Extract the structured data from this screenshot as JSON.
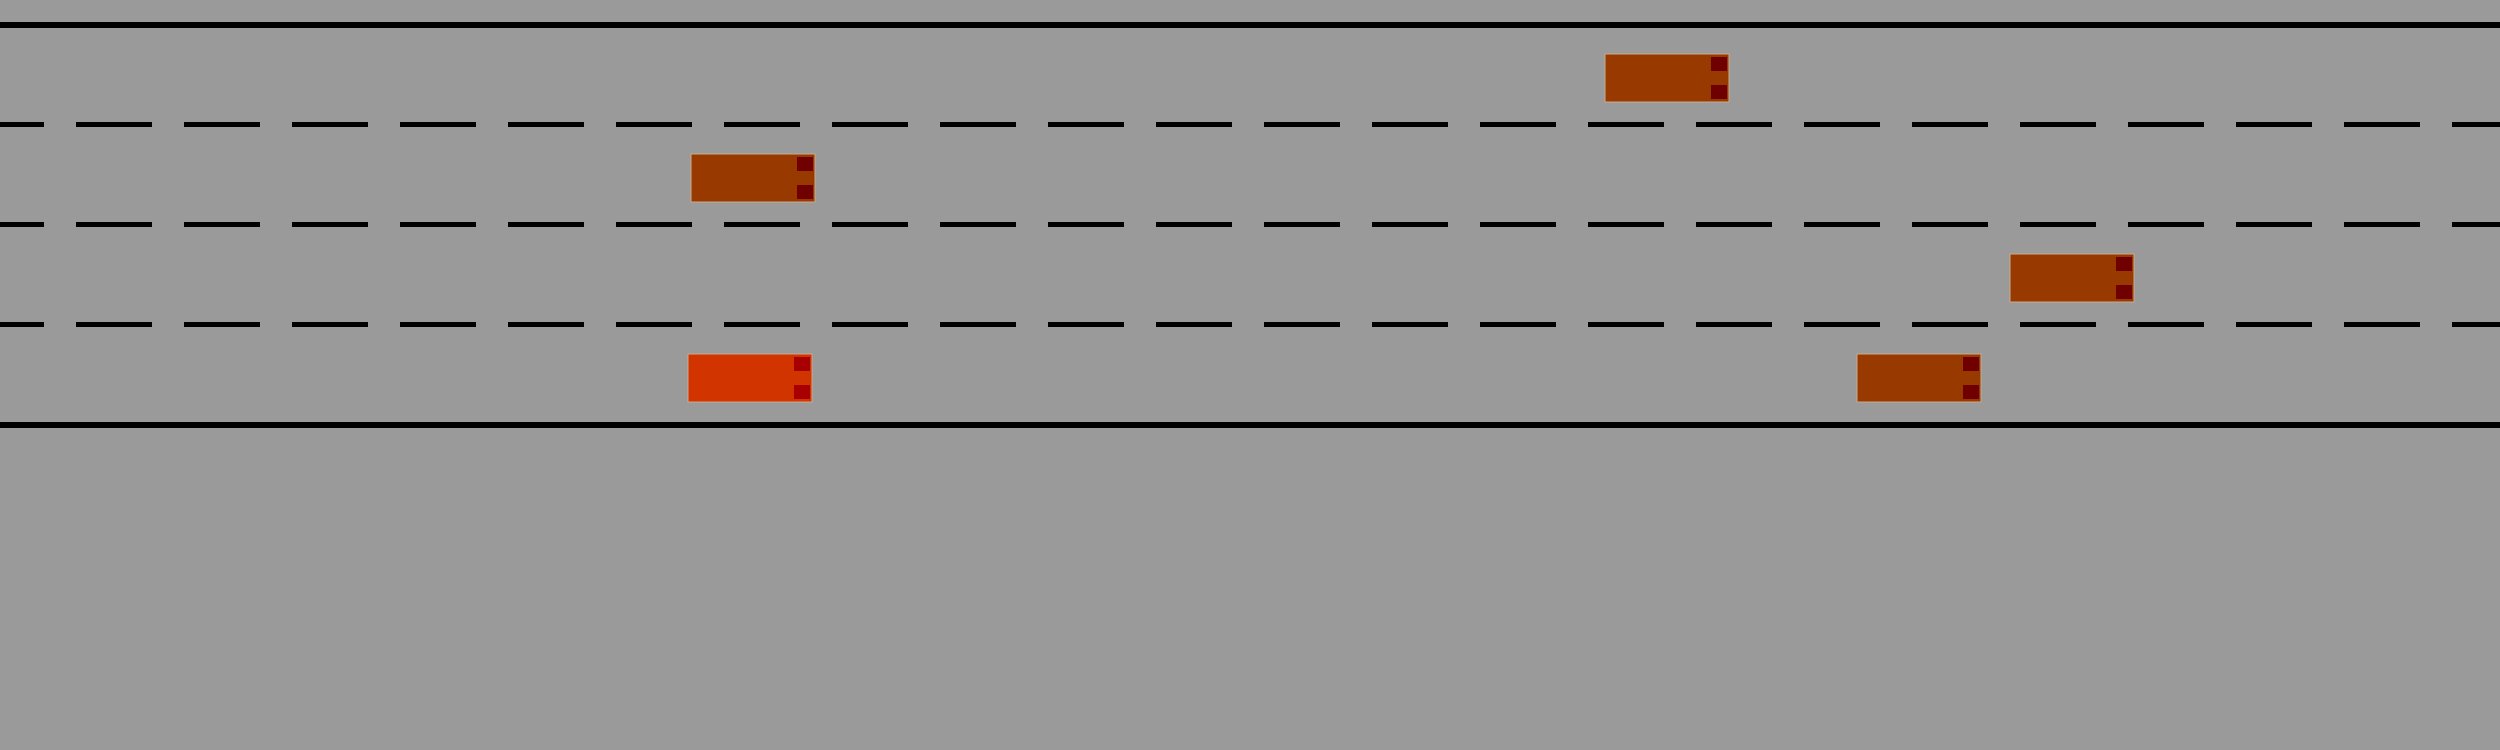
{
  "scene": {
    "type": "highway-driving-simulation",
    "background_color": "#9a9a9a",
    "road": {
      "lane_count": 4,
      "edge_line_color": "#000000",
      "lane_divider_color": "#000000",
      "lane_divider_style": "dashed"
    },
    "ego_vehicle": {
      "lane": 4,
      "body_color": "#d23400",
      "light_color": "#a80000"
    },
    "other_vehicles": [
      {
        "lane": 1,
        "body_color": "#983a00",
        "light_color": "#700000"
      },
      {
        "lane": 2,
        "body_color": "#983a00",
        "light_color": "#700000"
      },
      {
        "lane": 3,
        "body_color": "#983a00",
        "light_color": "#700000"
      },
      {
        "lane": 4,
        "body_color": "#983a00",
        "light_color": "#700000"
      }
    ]
  }
}
